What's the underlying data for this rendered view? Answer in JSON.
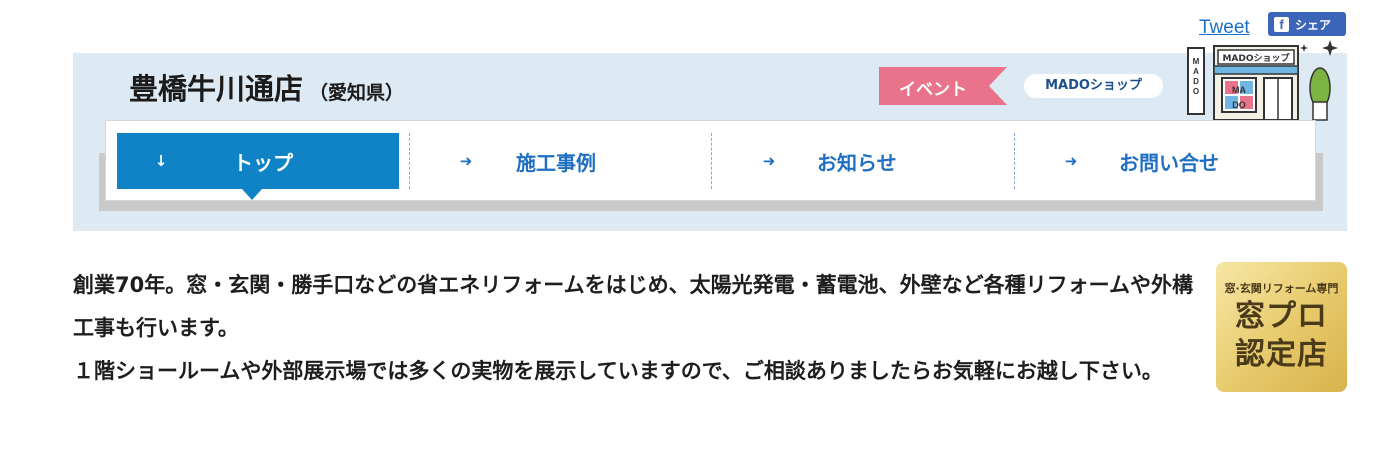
{
  "social": {
    "tweet_label": "Tweet",
    "share_label": "シェア",
    "share_icon": "f"
  },
  "header": {
    "store_name": "豊橋牛川通店",
    "prefecture": "（愛知県）",
    "event_tag": "イベント",
    "shop_pill": "MADOショップ",
    "illust_sign": "MADOショップ",
    "illust_vertical": "MADO",
    "illust_window": [
      "MA",
      "DO"
    ]
  },
  "nav": {
    "items": [
      {
        "label": "トップ",
        "arrow": "↓"
      },
      {
        "label": "施工事例",
        "arrow": "➜"
      },
      {
        "label": "お知らせ",
        "arrow": "➜"
      },
      {
        "label": "お問い合せ",
        "arrow": "➜"
      }
    ]
  },
  "description": {
    "paragraph1": "創業70年。窓・玄関・勝手口などの省エネリフォームをはじめ、太陽光発電・蓄電池、外壁など各種リフォームや外構工事も行います。",
    "paragraph2": "１階ショールームや外部展示場では多くの実物を展示していますので、ご相談ありましたらお気軽にお越し下さい。"
  },
  "badge": {
    "caption": "窓·玄関リフォーム専門",
    "line1": "窓プロ",
    "line2": "認定店"
  },
  "colors": {
    "band": "#dde9f3",
    "nav_active": "#1083c6",
    "nav_text": "#1e6ec2",
    "event_tag": "#e8738a",
    "facebook": "#3b65b8"
  }
}
